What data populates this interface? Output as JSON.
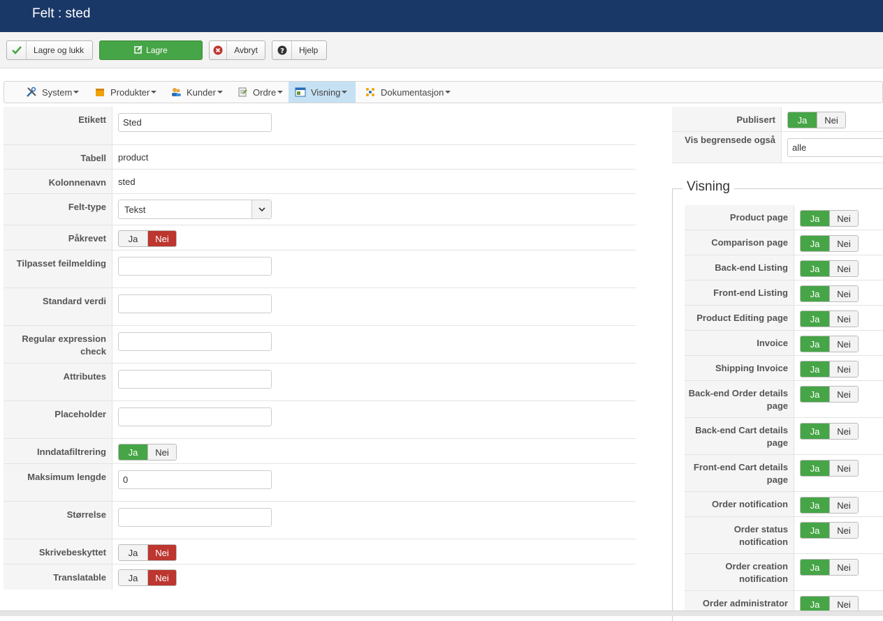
{
  "header": {
    "title": "Felt : sted"
  },
  "toolbar": {
    "save_close": "Lagre og lukk",
    "save": "Lagre",
    "cancel": "Avbryt",
    "help": "Hjelp"
  },
  "menu": [
    {
      "label": "System",
      "icon": "tools-icon"
    },
    {
      "label": "Produkter",
      "icon": "box-icon"
    },
    {
      "label": "Kunder",
      "icon": "users-icon"
    },
    {
      "label": "Ordre",
      "icon": "order-icon"
    },
    {
      "label": "Visning",
      "icon": "display-icon",
      "active": true
    },
    {
      "label": "Dokumentasjon",
      "icon": "docs-icon"
    }
  ],
  "form": {
    "etikett": {
      "label": "Etikett",
      "value": "Sted"
    },
    "tabell": {
      "label": "Tabell",
      "value": "product"
    },
    "kolonnenavn": {
      "label": "Kolonnenavn",
      "value": "sted"
    },
    "felttype": {
      "label": "Felt-type",
      "value": "Tekst"
    },
    "pakrevet": {
      "label": "Påkrevet",
      "yes": "Ja",
      "no": "Nei",
      "selected": "no"
    },
    "feilmelding": {
      "label": "Tilpasset feilmelding",
      "value": ""
    },
    "standard": {
      "label": "Standard verdi",
      "value": ""
    },
    "regex": {
      "label": "Regular expression check",
      "value": ""
    },
    "attributes": {
      "label": "Attributes",
      "value": ""
    },
    "placeholder": {
      "label": "Placeholder",
      "value": ""
    },
    "filtrering": {
      "label": "Inndatafiltrering",
      "yes": "Ja",
      "no": "Nei",
      "selected": "yes"
    },
    "maks": {
      "label": "Maksimum lengde",
      "value": "0"
    },
    "storrelse": {
      "label": "Størrelse",
      "value": ""
    },
    "skrive": {
      "label": "Skrivebeskyttet",
      "yes": "Ja",
      "no": "Nei",
      "selected": "no"
    },
    "translatable": {
      "label": "Translatable",
      "yes": "Ja",
      "no": "Nei",
      "selected": "no"
    }
  },
  "right": {
    "publisert": {
      "label": "Publisert",
      "yes": "Ja",
      "no": "Nei",
      "selected": "yes"
    },
    "vis": {
      "label": "Vis begrensede også",
      "value": "alle"
    }
  },
  "visning": {
    "legend": "Visning",
    "yes": "Ja",
    "no": "Nei",
    "items": [
      "Product page",
      "Comparison page",
      "Back-end Listing",
      "Front-end Listing",
      "Product Editing page",
      "Invoice",
      "Shipping Invoice",
      "Back-end Order details page",
      "Back-end Cart details page",
      "Front-end Cart details page",
      "Order notification",
      "Order status notification",
      "Order creation notification",
      "Order administrator"
    ]
  }
}
